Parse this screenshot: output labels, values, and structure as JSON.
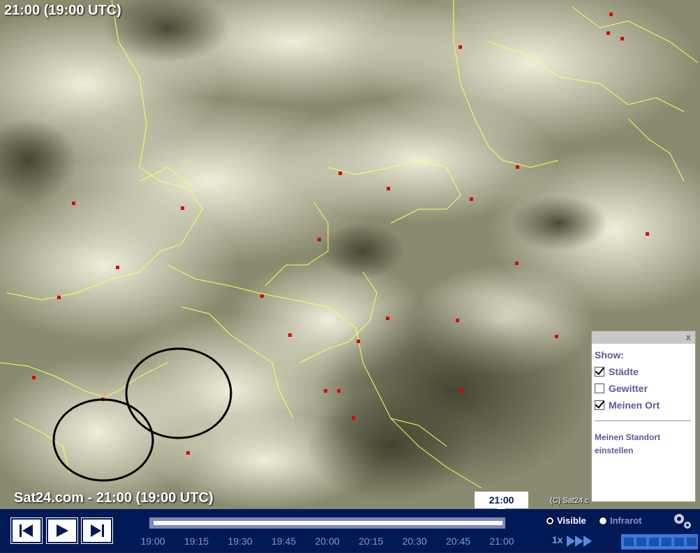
{
  "map": {
    "timestamp_top": "21:00 (19:00 UTC)",
    "brand": "Sat24.com - 21:00 (19:00 UTC)",
    "copyright": "(C) Sat24.c",
    "colors": {
      "cloud": "#f0efd8",
      "ground": "#5a5a44",
      "border": "#ffff55",
      "city": "#e00000"
    }
  },
  "panel": {
    "close": "x",
    "show_label": "Show:",
    "options": [
      {
        "label": "Städte",
        "checked": true
      },
      {
        "label": "Gewitter",
        "checked": false
      },
      {
        "label": "Meinen Ort",
        "checked": true
      }
    ],
    "location_link": "Meinen Standort einstellen"
  },
  "controls": {
    "current_time": "21:00",
    "ticks": [
      "19:00",
      "19:15",
      "19:30",
      "19:45",
      "20:00",
      "20:15",
      "20:30",
      "20:45",
      "21:00"
    ],
    "progress": 1.0,
    "radio": [
      {
        "label": "Visible",
        "selected": true
      },
      {
        "label": "Infrarot",
        "selected": false
      }
    ],
    "speed": "1x",
    "icons": {
      "first": "skip-back-icon",
      "play": "play-icon",
      "last": "skip-forward-icon",
      "settings": "gear-icon",
      "speed": "fast-forward-icon"
    }
  }
}
